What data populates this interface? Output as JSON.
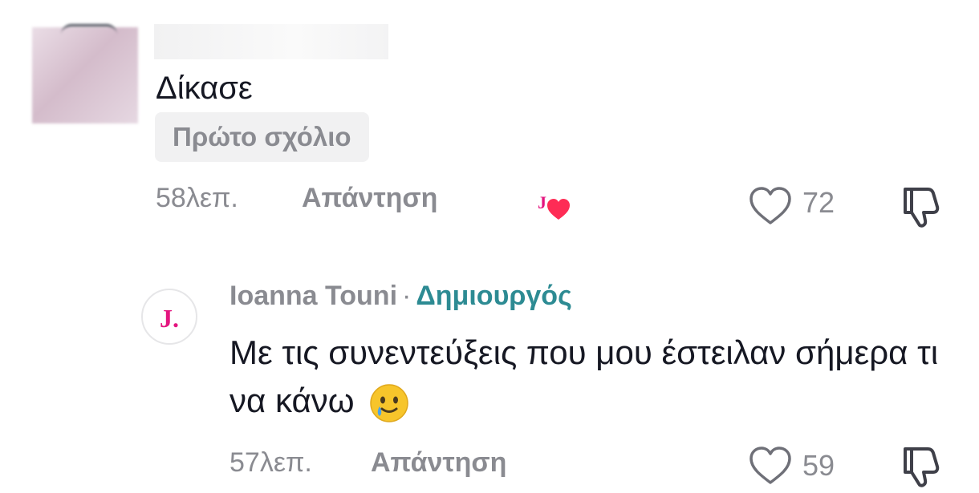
{
  "comments": [
    {
      "text": "Δίκασε",
      "badge": "Πρώτο σχόλιο",
      "time": "58λεπ.",
      "reply_label": "Απάντηση",
      "likes": "72"
    }
  ],
  "reply": {
    "author": "Ioanna Touni",
    "separator": "·",
    "role": "Δημιουργός",
    "avatar_initial": "J.",
    "text": "Με τις συνεντεύξεις που μου έστειλαν σήμερα τι να κάνω",
    "time": "57λεπ.",
    "reply_label": "Απάντηση",
    "likes": "59"
  },
  "icons": {
    "like": "heart-outline-icon",
    "dislike": "thumbs-down-icon",
    "creator_liked": "creator-liked-heart-icon",
    "emoji": "smiling-face-with-tear-emoji"
  },
  "colors": {
    "accent_pink": "#e4157f",
    "heart_red": "#fe2c55",
    "creator_teal": "#2d8b93",
    "meta_gray": "#8a8b91"
  }
}
